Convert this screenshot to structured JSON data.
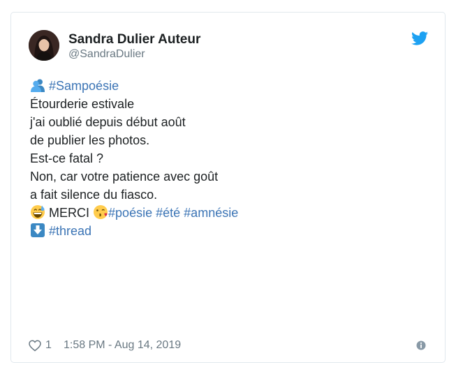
{
  "author": {
    "name": "Sandra Dulier Auteur",
    "handle": "@SandraDulier"
  },
  "tweet": {
    "hashtag_intro": "#Sampoésie",
    "stanza1": [
      "Étourderie estivale",
      "j'ai oublié depuis début août",
      "de publier les photos."
    ],
    "stanza2": [
      "Est-ce fatal ?",
      "Non, car votre patience avec goût",
      "a fait silence du fiasco."
    ],
    "merci": "MERCI",
    "hashtags": [
      "#poésie",
      "#été",
      "#amnésie"
    ],
    "thread_hashtag": "#thread"
  },
  "footer": {
    "likes": "1",
    "timestamp": "1:58 PM - Aug 14, 2019"
  },
  "icons": {
    "brand": "twitter-bird-icon",
    "heart": "heart-icon",
    "info": "info-icon",
    "silhouette": "busts-in-silhouette-emoji",
    "sweat_smile": "grinning-sweat-emoji",
    "kiss": "face-blowing-kiss-emoji",
    "down_arrow": "down-arrow-emoji"
  },
  "colors": {
    "link": "#3b74b5",
    "twitter_blue": "#1da1f2",
    "muted": "#697882",
    "border": "#e1e8ed"
  }
}
